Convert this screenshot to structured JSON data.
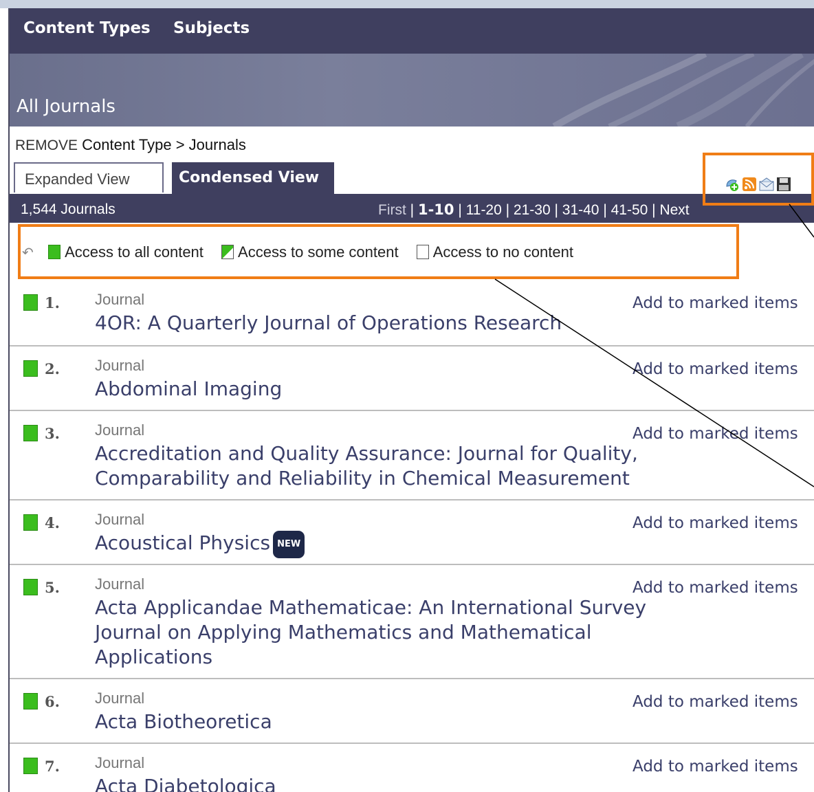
{
  "nav": {
    "items": [
      "Content Types",
      "Subjects"
    ]
  },
  "banner": {
    "title": "All Journals"
  },
  "breadcrumb": {
    "remove": "REMOVE",
    "path": "Content Type > Journals"
  },
  "tabs": {
    "expanded": "Expanded View",
    "condensed": "Condensed View"
  },
  "toolbar": {
    "icons": [
      "add-alert-icon",
      "rss-feed-icon",
      "email-icon",
      "save-icon"
    ]
  },
  "results": {
    "count": "1,544 Journals",
    "pager": {
      "first": "First",
      "current": "1-10",
      "p2": "11-20",
      "p3": "21-30",
      "p4": "31-40",
      "p5": "41-50",
      "next": "Next"
    }
  },
  "legend": {
    "all": "Access to all content",
    "some": "Access to some content",
    "none": "Access to no content"
  },
  "items": [
    {
      "num": "1.",
      "type": "Journal",
      "title": "4OR: A Quarterly Journal of Operations Research",
      "action": "Add to marked items"
    },
    {
      "num": "2.",
      "type": "Journal",
      "title": "Abdominal Imaging",
      "action": "Add to marked items"
    },
    {
      "num": "3.",
      "type": "Journal",
      "title": "Accreditation and Quality Assurance: Journal for Quality, Comparability and Reliability in Chemical Measurement",
      "action": "Add to marked items"
    },
    {
      "num": "4.",
      "type": "Journal",
      "title": "Acoustical Physics",
      "badge": "NEW",
      "action": "Add to marked items"
    },
    {
      "num": "5.",
      "type": "Journal",
      "title": "Acta Applicandae Mathematicae: An International Survey Journal on Applying Mathematics and Mathematical Applications",
      "action": "Add to marked items"
    },
    {
      "num": "6.",
      "type": "Journal",
      "title": "Acta Biotheoretica",
      "action": "Add to marked items"
    },
    {
      "num": "7.",
      "type": "Journal",
      "title": "Acta Diabetologica",
      "action": "Add to marked items"
    }
  ],
  "colors": {
    "nav": "#3f3f5f",
    "access_full": "#3bbd1e",
    "highlight": "#f07d16",
    "link": "#3a3f6a"
  }
}
